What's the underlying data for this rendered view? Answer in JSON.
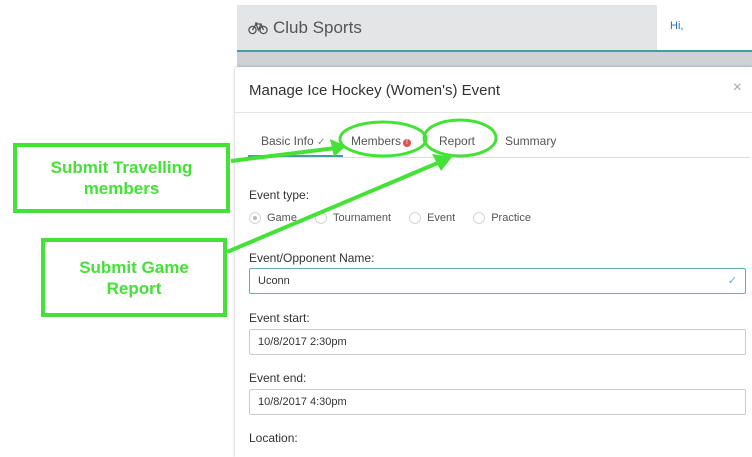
{
  "app": {
    "title": "Club Sports",
    "greeting": "Hi,"
  },
  "modal": {
    "title": "Manage Ice Hockey (Women's) Event",
    "close_glyph": "×",
    "tabs": [
      {
        "label": "Basic Info",
        "suffix": "✓"
      },
      {
        "label": "Members",
        "badge": "!"
      },
      {
        "label": "Report"
      },
      {
        "label": "Summary"
      }
    ],
    "event_type": {
      "label": "Event type:",
      "options": [
        "Game",
        "Tournament",
        "Event",
        "Practice"
      ],
      "selected": "Game"
    },
    "opponent": {
      "label": "Event/Opponent Name:",
      "value": "Uconn",
      "check": "✓"
    },
    "event_start": {
      "label": "Event start:",
      "value": "10/8/2017 2:30pm"
    },
    "event_end": {
      "label": "Event end:",
      "value": "10/8/2017 4:30pm"
    },
    "location": {
      "label": "Location:"
    }
  },
  "annotations": {
    "callout_members": [
      "Submit Travelling",
      "members"
    ],
    "callout_report": [
      "Submit Game",
      "Report"
    ],
    "color": "#44e236"
  },
  "colors": {
    "accent": "#4a9aa5",
    "badge": "#d9534f",
    "link": "#2f6fb3"
  }
}
